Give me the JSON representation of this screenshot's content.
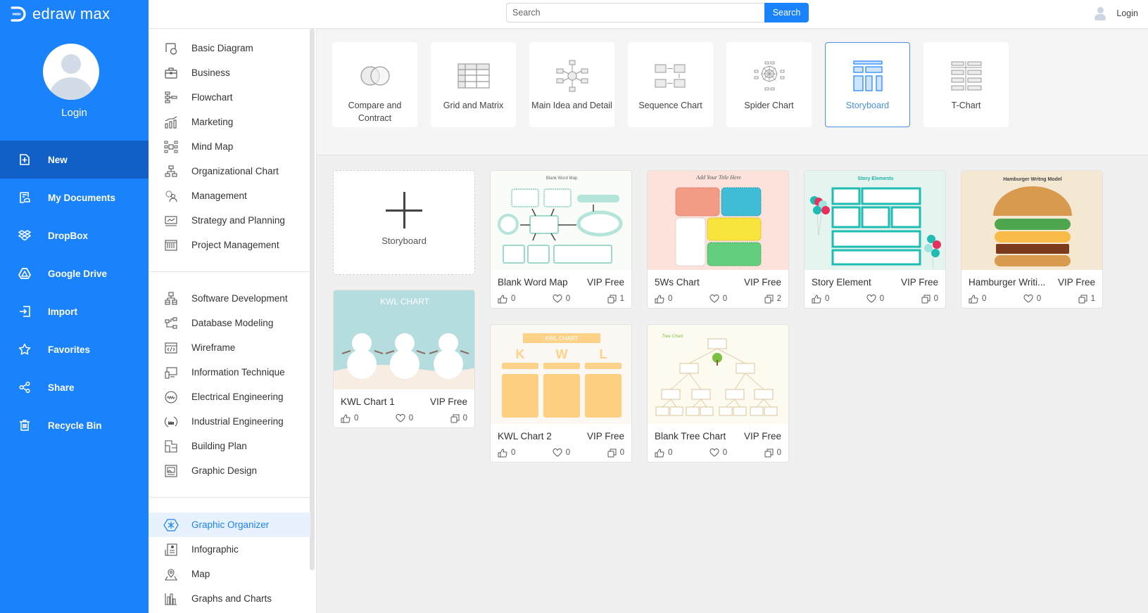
{
  "app": {
    "name": "edraw max"
  },
  "sidebar": {
    "login_label": "Login",
    "items": [
      {
        "label": "New",
        "icon": "new-file-icon",
        "active": true
      },
      {
        "label": "My Documents",
        "icon": "documents-icon"
      },
      {
        "label": "DropBox",
        "icon": "dropbox-icon"
      },
      {
        "label": "Google Drive",
        "icon": "google-drive-icon"
      },
      {
        "label": "Import",
        "icon": "import-icon"
      },
      {
        "label": "Favorites",
        "icon": "star-icon"
      },
      {
        "label": "Share",
        "icon": "share-icon"
      },
      {
        "label": "Recycle Bin",
        "icon": "trash-icon"
      }
    ]
  },
  "topbar": {
    "search_placeholder": "Search",
    "search_button": "Search",
    "login_label": "Login"
  },
  "categories": {
    "group1": [
      {
        "label": "Basic Diagram",
        "icon": "basic-diagram-icon"
      },
      {
        "label": "Business",
        "icon": "briefcase-icon"
      },
      {
        "label": "Flowchart",
        "icon": "flowchart-icon"
      },
      {
        "label": "Marketing",
        "icon": "bar-growth-icon"
      },
      {
        "label": "Mind Map",
        "icon": "mind-map-icon"
      },
      {
        "label": "Organizational Chart",
        "icon": "org-chart-icon"
      },
      {
        "label": "Management",
        "icon": "management-icon"
      },
      {
        "label": "Strategy and Planning",
        "icon": "strategy-icon"
      },
      {
        "label": "Project Management",
        "icon": "project-icon"
      }
    ],
    "group2": [
      {
        "label": "Software Development",
        "icon": "software-icon"
      },
      {
        "label": "Database Modeling",
        "icon": "database-icon"
      },
      {
        "label": "Wireframe",
        "icon": "wireframe-icon"
      },
      {
        "label": "Information Technique",
        "icon": "devices-icon"
      },
      {
        "label": "Electrical Engineering",
        "icon": "electrical-icon"
      },
      {
        "label": "Industrial Engineering",
        "icon": "industrial-icon"
      },
      {
        "label": "Building Plan",
        "icon": "floor-plan-icon"
      },
      {
        "label": "Graphic Design",
        "icon": "graphic-design-icon"
      }
    ],
    "group3": [
      {
        "label": "Graphic Organizer",
        "icon": "graphic-organizer-icon",
        "active": true
      },
      {
        "label": "Infographic",
        "icon": "infographic-icon"
      },
      {
        "label": "Map",
        "icon": "map-pin-icon"
      },
      {
        "label": "Graphs and Charts",
        "icon": "chart-bars-icon"
      }
    ]
  },
  "types": [
    {
      "label": "Compare and Contract",
      "icon": "venn-icon"
    },
    {
      "label": "Grid and Matrix",
      "icon": "grid-icon"
    },
    {
      "label": "Main Idea and Detail",
      "icon": "main-idea-icon"
    },
    {
      "label": "Sequence Chart",
      "icon": "sequence-icon"
    },
    {
      "label": "Spider Chart",
      "icon": "spider-icon"
    },
    {
      "label": "Storyboard",
      "icon": "storyboard-icon",
      "active": true
    },
    {
      "label": "T-Chart",
      "icon": "t-chart-icon"
    }
  ],
  "new_card": {
    "label": "Storyboard"
  },
  "templates": [
    {
      "title": "Blank Word Map",
      "badge": "VIP Free",
      "likes": "0",
      "favorites": "0",
      "copies": "1",
      "thumb_title": "Blank Word Map"
    },
    {
      "title": "5Ws Chart",
      "badge": "VIP Free",
      "likes": "0",
      "favorites": "0",
      "copies": "2",
      "thumb_title": "Add Your Title Here"
    },
    {
      "title": "Story Element",
      "badge": "VIP Free",
      "likes": "0",
      "favorites": "0",
      "copies": "0",
      "thumb_title": "Story Elements"
    },
    {
      "title": "Hamburger Writi...",
      "badge": "VIP Free",
      "likes": "0",
      "favorites": "0",
      "copies": "1",
      "thumb_title": "Hamburger Writng Model"
    },
    {
      "title": "KWL Chart 1",
      "badge": "VIP Free",
      "likes": "0",
      "favorites": "0",
      "copies": "0",
      "thumb_title": "KWL CHART"
    },
    {
      "title": "KWL Chart 2",
      "badge": "VIP Free",
      "likes": "0",
      "favorites": "0",
      "copies": "0",
      "thumb_title": "KWL CHART"
    },
    {
      "title": "Blank Tree Chart",
      "badge": "VIP Free",
      "likes": "0",
      "favorites": "0",
      "copies": "0",
      "thumb_title": "Tree Chart"
    }
  ],
  "colors": {
    "brand": "#1a82fb",
    "nav_active": "#1160c8",
    "selected": "#4a90e2"
  }
}
